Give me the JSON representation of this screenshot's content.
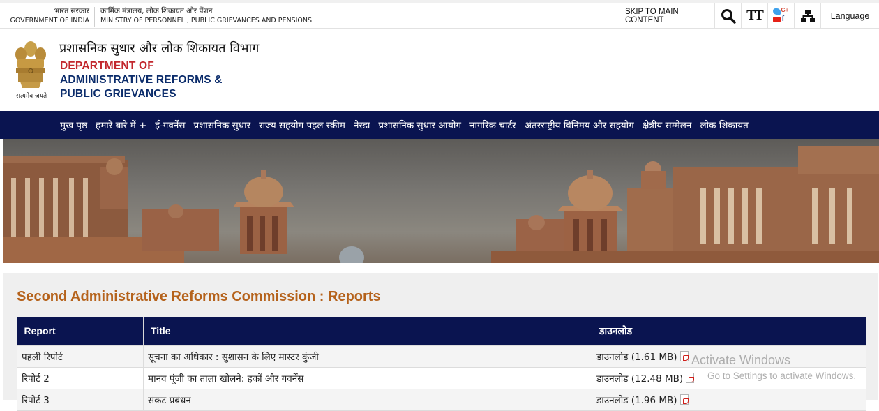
{
  "topbar": {
    "gov_hi": "भारत सरकार",
    "gov_en": "GOVERNMENT OF INDIA",
    "ministry_hi": "कार्मिक मंत्रालय, लोक शिकायत और पेंशन",
    "ministry_en": "MINISTRY OF PERSONNEL , PUBLIC GRIEVANCES AND PENSIONS",
    "skip_label": "SKIP TO MAIN CONTENT",
    "text_size_label": "TT",
    "language_label": "Language"
  },
  "header": {
    "emblem_caption": "सत्यमेव जयते",
    "dept_hi": "प्रशासनिक सुधार और लोक शिकायत विभाग",
    "dept_en_1": "DEPARTMENT OF",
    "dept_en_2": "ADMINISTRATIVE REFORMS &",
    "dept_en_3": "PUBLIC GRIEVANCES"
  },
  "nav": {
    "items": [
      {
        "label": "मुख पृष्ठ"
      },
      {
        "label": "हमारे बारे में +"
      },
      {
        "label": "ई-गवर्नेंस"
      },
      {
        "label": "प्रशासनिक सुधार"
      },
      {
        "label": "राज्य सहयोग पहल स्कीम"
      },
      {
        "label": "नेस्डा"
      },
      {
        "label": "प्रशासनिक सुधार आयोग"
      },
      {
        "label": "नागरिक चार्टर"
      },
      {
        "label": "अंतरराष्ट्रीय विनिमय और सहयोग"
      },
      {
        "label": "क्षेत्रीय सम्मेलन"
      },
      {
        "label": "लोक शिकायत"
      }
    ]
  },
  "main": {
    "page_title": "Second Administrative Reforms Commission : Reports",
    "table": {
      "headers": [
        "Report",
        "Title",
        "डाउनलोड"
      ],
      "rows": [
        {
          "report": "पहली रिपोर्ट",
          "title": "सूचना का अधिकार : सुशासन के लिए मास्टर कुंजी",
          "download": "डाउनलोड (1.61 MB)"
        },
        {
          "report": "रिपोर्ट 2",
          "title": "मानव पूंजी का ताला खोलने: हकों और गवर्नेंस",
          "download": "डाउनलोड (12.48 MB)"
        },
        {
          "report": "रिपोर्ट 3",
          "title": "संकट प्रबंधन",
          "download": "डाउनलोड (1.96 MB)"
        }
      ]
    }
  },
  "watermark": {
    "line1": "Activate Windows",
    "line2": "Go to Settings to activate Windows."
  },
  "icons": [
    "search-icon",
    "text-size-icon",
    "social-media-icon",
    "sitemap-icon",
    "pdf-icon",
    "state-emblem"
  ]
}
